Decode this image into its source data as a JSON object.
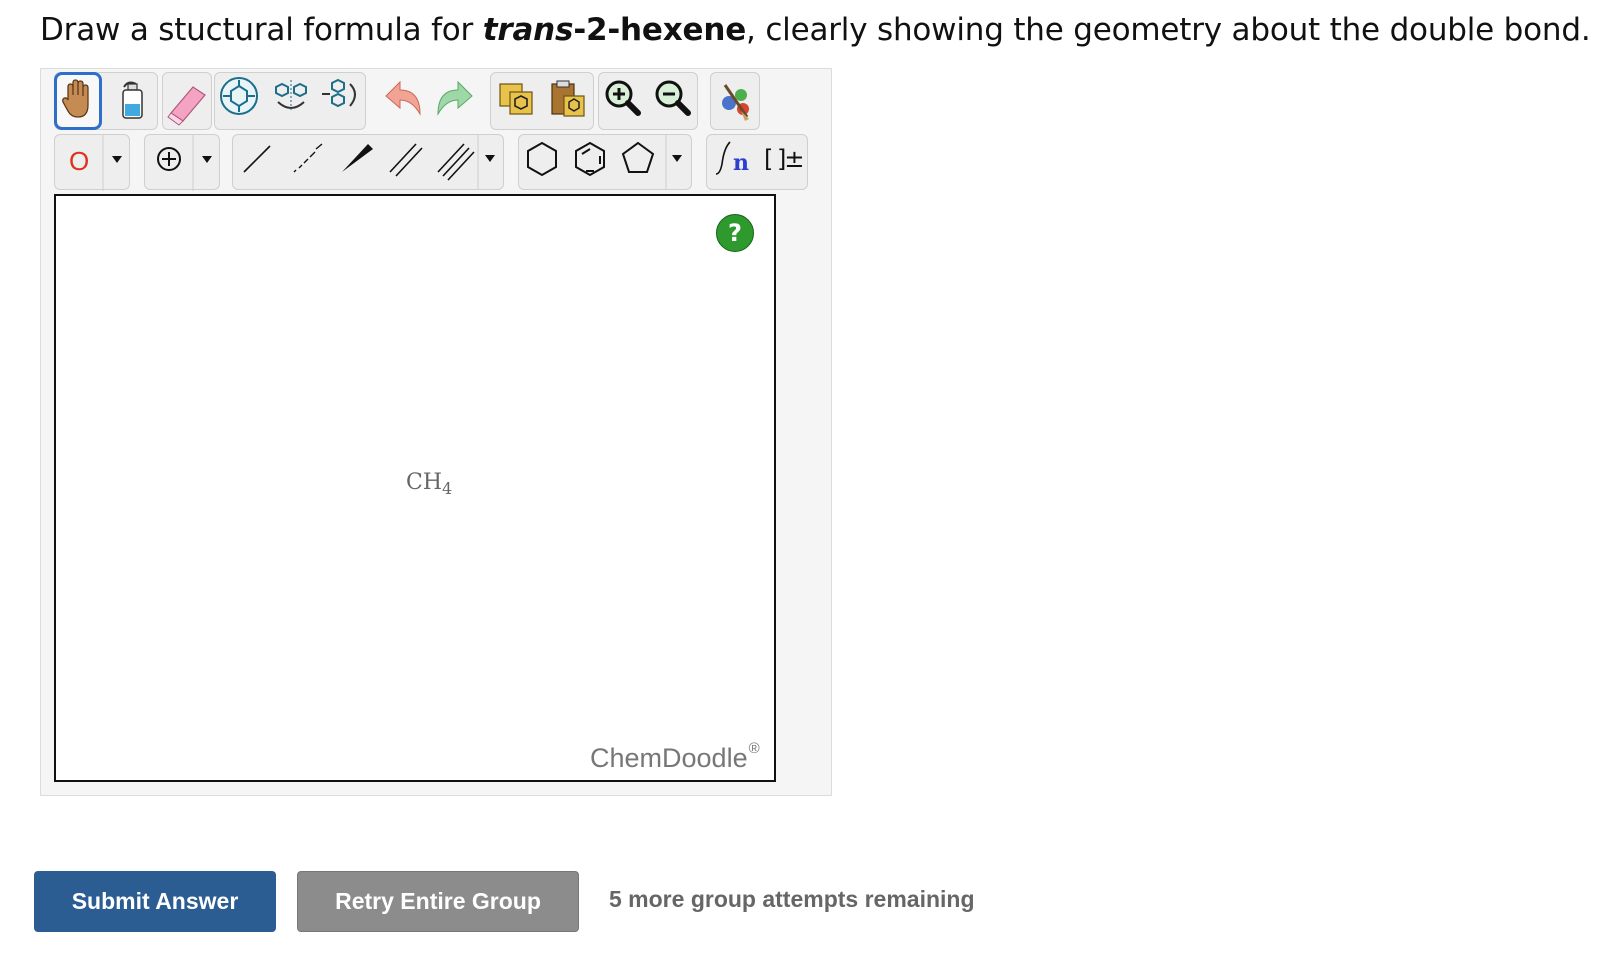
{
  "question": {
    "prefix": "Draw a stuctural formula for ",
    "compound_italic": "trans",
    "compound_rest": "-2-hexene",
    "suffix": ", clearly showing the geometry about the double bond."
  },
  "toolbar": {
    "row1": [
      "hand-icon",
      "clear-bottle-icon",
      "eraser-icon",
      "center-molecule-icon",
      "flip-icon",
      "rotate-icon",
      "undo-icon",
      "redo-icon",
      "copy-icon",
      "paste-icon",
      "zoom-in-icon",
      "zoom-out-icon",
      "clean-up-icon"
    ],
    "row2": [
      "atom-label",
      "charge-icon",
      "single-bond-icon",
      "hash-bond-icon",
      "wedge-bond-icon",
      "double-bond-icon",
      "triple-bond-icon",
      "hexagon-icon",
      "benzene-icon",
      "pentagon-icon",
      "repeat-unit-icon",
      "bracket-icon"
    ],
    "atom_label": "O",
    "repeat_unit_label": "n",
    "bracket_label": "[ ]±",
    "accent_color": "#2f6fc7",
    "atom_color": "#e0301e"
  },
  "canvas": {
    "molecule_main": "CH",
    "molecule_sub": "4",
    "help_label": "?",
    "brand": "ChemDoodle",
    "brand_mark": "®"
  },
  "actions": {
    "submit_label": "Submit Answer",
    "retry_label": "Retry Entire Group",
    "attempts_text": "5 more group attempts remaining"
  }
}
